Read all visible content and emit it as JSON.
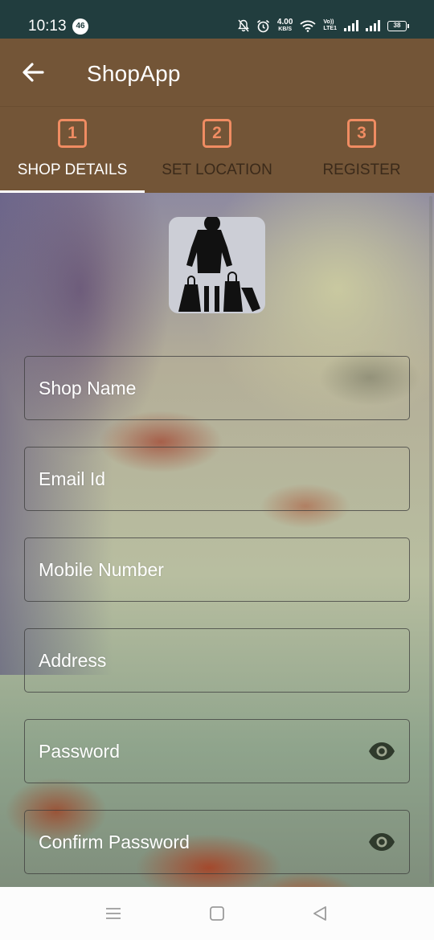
{
  "status_bar": {
    "time": "10:13",
    "notification_count": "46",
    "net_speed_value": "4.00",
    "net_speed_unit": "KB/S",
    "volte_top": "Vo))",
    "volte_bottom": "LTE1",
    "battery": "38"
  },
  "toolbar": {
    "title": "ShopApp",
    "back_icon": "arrow-left-icon"
  },
  "tabs": [
    {
      "number": "1",
      "label": "SHOP DETAILS",
      "active": true
    },
    {
      "number": "2",
      "label": "SET LOCATION",
      "active": false
    },
    {
      "number": "3",
      "label": "REGISTER",
      "active": false
    }
  ],
  "form": {
    "logo_icon": "shopper-with-bags-icon",
    "fields": [
      {
        "label": "Shop Name"
      },
      {
        "label": "Email Id"
      },
      {
        "label": "Mobile Number"
      },
      {
        "label": "Address"
      },
      {
        "label": "Password",
        "icon": "eye-icon"
      },
      {
        "label": "Confirm Password",
        "icon": "eye-icon"
      }
    ]
  },
  "nav_bar": {
    "icons": [
      "menu-icon",
      "home-square-icon",
      "back-triangle-icon"
    ]
  },
  "colors": {
    "status_bar": "#213d3e",
    "app_bar": "#735537",
    "step_accent": "#f08c62",
    "inactive_tab_text": "#3b2a1a"
  }
}
